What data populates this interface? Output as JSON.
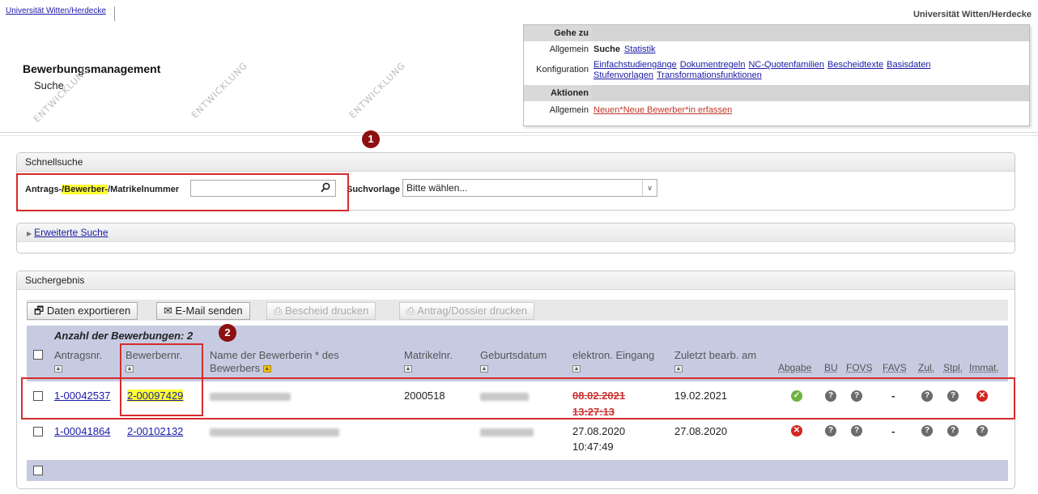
{
  "topbar": {
    "tab_label": "Universität Witten/Herdecke",
    "brand": "Universität Witten/Herdecke"
  },
  "app": {
    "title": "Bewerbungsmanagement",
    "subtitle": "Suche"
  },
  "watermark": "ENTWICKLUNG",
  "goto": {
    "head_label": "Gehe zu",
    "row1_label": "Allgemein",
    "row1_current": "Suche",
    "row1_links": [
      "Statistik"
    ],
    "row2_label": "Konfiguration",
    "row2_links": [
      "Einfachstudiengänge",
      "Dokumentregeln",
      "NC-Quotenfamilien",
      "Bescheidtexte",
      "Basisdaten"
    ],
    "row2_links_line2": [
      "Stufenvorlagen",
      "Transformationsfunktionen"
    ],
    "actions_label": "Aktionen",
    "row3_label": "Allgemein",
    "row3_link": "Neuen*Neue Bewerber*in erfassen"
  },
  "quicksearch": {
    "title": "Schnellsuche",
    "label_pre": "Antrags-",
    "label_hl": "/Bewerber-",
    "label_post": "/Matrikelnummer",
    "input_value": "",
    "vorlage_label": "Suchvorlage",
    "vorlage_value": "Bitte wählen..."
  },
  "extended": {
    "label": "Erweiterte Suche"
  },
  "results": {
    "title": "Suchergebnis",
    "buttons": {
      "export": "Daten exportieren",
      "email": "E-Mail senden",
      "bescheid": "Bescheid drucken",
      "dossier": "Antrag/Dossier drucken"
    },
    "count_label": "Anzahl der Bewerbungen: 2",
    "columns": {
      "antragsnr": "Antragsnr.",
      "bewerbernr": "Bewerbernr.",
      "name": "Name der Bewerberin * des Bewerbers",
      "matrikel": "Matrikelnr.",
      "geburt": "Geburtsdatum",
      "eingang": "elektron. Eingang",
      "zuletzt": "Zuletzt bearb. am",
      "abgabe": "Abgabe",
      "bu": "BU",
      "fovs": "FOVS",
      "favs": "FAVS",
      "zul": "Zul.",
      "stpl": "Stpl.",
      "immat": "Immat."
    },
    "rows": [
      {
        "antragsnr": "1-00042537",
        "bewerbernr": "2-00097429",
        "matrikel": "2000518",
        "eingang_date": "08.02.2021",
        "eingang_time": "13:27:13",
        "zuletzt": "19.02.2021",
        "favs": "-"
      },
      {
        "antragsnr": "1-00041864",
        "bewerbernr": "2-00102132",
        "matrikel": "",
        "eingang_date": "27.08.2020",
        "eingang_time": "10:47:49",
        "zuletzt": "27.08.2020",
        "favs": "-"
      }
    ]
  },
  "markers": [
    "1",
    "2"
  ],
  "colors": {
    "link": "#1a1aa6",
    "highlight_box": "#d62c2c",
    "grid_header": "#c7cbe2",
    "marker": "#8b1010",
    "ok": "#6db33f",
    "error": "#d2271f"
  }
}
